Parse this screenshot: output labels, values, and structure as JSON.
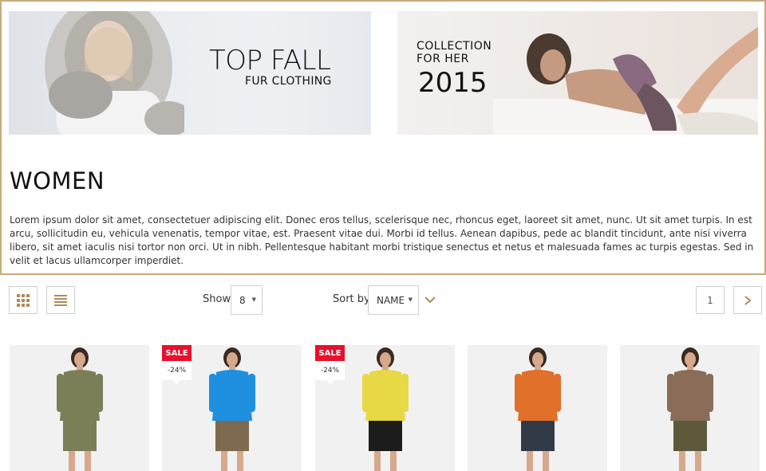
{
  "banners": {
    "left": {
      "title": "TOP FALL",
      "subtitle": "FUR CLOTHING"
    },
    "right": {
      "line1": "COLLECTION",
      "line2": "FOR HER",
      "year": "2015"
    }
  },
  "category": {
    "title": "WOMEN",
    "description": "Lorem ipsum dolor sit amet, consectetuer adipiscing elit. Donec eros tellus, scelerisque nec, rhoncus eget, laoreet sit amet, nunc. Ut sit amet turpis. In est arcu, sollicitudin eu, vehicula venenatis, tempor vitae, est. Praesent vitae dui. Morbi id tellus. Aenean dapibus, pede ac blandit tincidunt, ante nisi viverra libero, sit amet iaculis nisi tortor non orci. Ut in nibh. Pellentesque habitant morbi tristique senectus et netus et malesuada fames ac turpis egestas. Sed in velit et lacus ullamcorper imperdiet."
  },
  "toolbar": {
    "grid_icon": "grid-icon",
    "list_icon": "list-icon",
    "show_label": "Show",
    "show_value": "8",
    "sort_label": "Sort by",
    "sort_value": "NAME",
    "sort_direction_icon": "chevron-down-icon",
    "current_page": "1",
    "next_icon": "chevron-right-icon"
  },
  "products": [
    {
      "sale": false,
      "sale_label": "",
      "discount": "",
      "top_color": "#7b7f58",
      "bottom_color": "#7b7f58"
    },
    {
      "sale": true,
      "sale_label": "SALE",
      "discount": "-24%",
      "top_color": "#1f8fe0",
      "bottom_color": "#7d6a4f"
    },
    {
      "sale": true,
      "sale_label": "SALE",
      "discount": "-24%",
      "top_color": "#e7d845",
      "bottom_color": "#1c1c1c"
    },
    {
      "sale": false,
      "sale_label": "",
      "discount": "",
      "top_color": "#e0702a",
      "bottom_color": "#333a47"
    },
    {
      "sale": false,
      "sale_label": "",
      "discount": "",
      "top_color": "#8a6c58",
      "bottom_color": "#5d5a3c"
    }
  ],
  "colors": {
    "accent_border": "#c8a97e",
    "sale_red": "#e8102c"
  }
}
